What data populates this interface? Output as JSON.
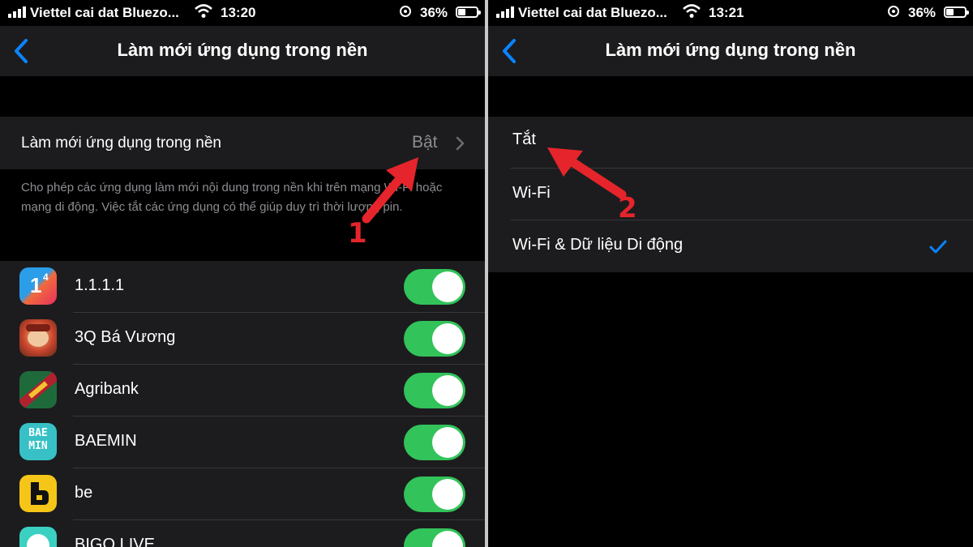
{
  "colors": {
    "accent": "#0a84ff",
    "toggle_on": "#32c35a",
    "cell_bg": "#1c1c1e",
    "annotation": "#e5252b"
  },
  "left": {
    "status": {
      "carrier": "Viettel cai dat Bluezo...",
      "time": "13:20",
      "battery": "36%"
    },
    "nav": {
      "title": "Làm mới ứng dụng trong nền",
      "back_icon": "chevron-left-icon"
    },
    "setting": {
      "label": "Làm mới ứng dụng trong nền",
      "value": "Bật"
    },
    "footer": "Cho phép các ứng dụng làm mới nội dung trong nền khi trên mạng Wi-Fi hoặc mạng di động. Việc tắt các ứng dụng có thể giúp duy trì thời lượng pin.",
    "apps": [
      {
        "name": "1.1.1.1",
        "on": true
      },
      {
        "name": "3Q Bá Vương",
        "on": true
      },
      {
        "name": "Agribank",
        "on": true
      },
      {
        "name": "BAEMIN",
        "on": true
      },
      {
        "name": "be",
        "on": true
      },
      {
        "name": "BIGO LIVE",
        "on": true
      }
    ],
    "icon_text": {
      "one": "1",
      "one_sup": "4",
      "baemin": "BAE MIN"
    },
    "annotation": "1"
  },
  "right": {
    "status": {
      "carrier": "Viettel cai dat Bluezo...",
      "time": "13:21",
      "battery": "36%"
    },
    "nav": {
      "title": "Làm mới ứng dụng trong nền",
      "back_icon": "chevron-left-icon"
    },
    "options": [
      {
        "label": "Tắt",
        "selected": false
      },
      {
        "label": "Wi-Fi",
        "selected": false
      },
      {
        "label": "Wi-Fi & Dữ liệu Di động",
        "selected": true
      }
    ],
    "annotation": "2"
  }
}
